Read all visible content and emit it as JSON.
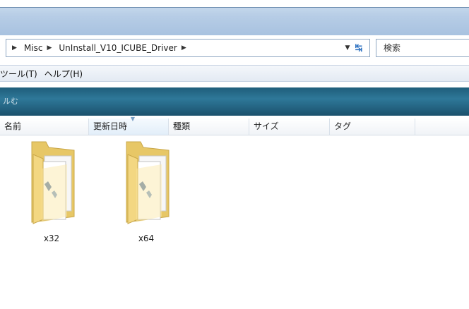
{
  "address": {
    "crumbs": [
      "Misc",
      "UnInstall_V10_ICUBE_Driver"
    ],
    "search_placeholder": "検索"
  },
  "menu": {
    "items": [
      "ツール(T)",
      "ヘルプ(H)"
    ]
  },
  "toolbar": {
    "label": "ルむ"
  },
  "columns": [
    "名前",
    "更新日時",
    "種類",
    "サイズ",
    "タグ"
  ],
  "items": [
    {
      "name": "x32",
      "icon": "folder-icon"
    },
    {
      "name": "x64",
      "icon": "folder-icon"
    }
  ],
  "colors": {
    "toolbar": "#2e7899",
    "folder": "#f1d27a"
  }
}
